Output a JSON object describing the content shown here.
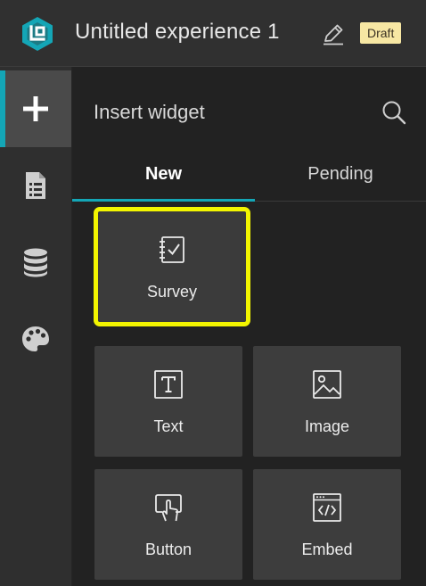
{
  "header": {
    "title": "Untitled experience 1",
    "badge": "Draft",
    "logo_icon": "experience-builder-logo",
    "edit_icon": "pencil-icon"
  },
  "rail": {
    "items": [
      {
        "icon": "plus-icon",
        "active": true
      },
      {
        "icon": "page-icon",
        "active": false
      },
      {
        "icon": "database-icon",
        "active": false
      },
      {
        "icon": "palette-icon",
        "active": false
      }
    ]
  },
  "panel": {
    "title": "Insert widget",
    "tabs": [
      {
        "label": "New",
        "selected": true
      },
      {
        "label": "Pending",
        "selected": false
      }
    ],
    "widgets": [
      {
        "label": "Survey",
        "icon": "survey-icon",
        "highlighted": true
      },
      {
        "label": "Text",
        "icon": "text-icon"
      },
      {
        "label": "Image",
        "icon": "image-icon"
      },
      {
        "label": "Button",
        "icon": "button-icon"
      },
      {
        "label": "Embed",
        "icon": "embed-icon"
      }
    ]
  },
  "colors": {
    "accent": "#14a6b6",
    "highlight": "#f3f500",
    "badge_bg": "#f7e7a3"
  }
}
